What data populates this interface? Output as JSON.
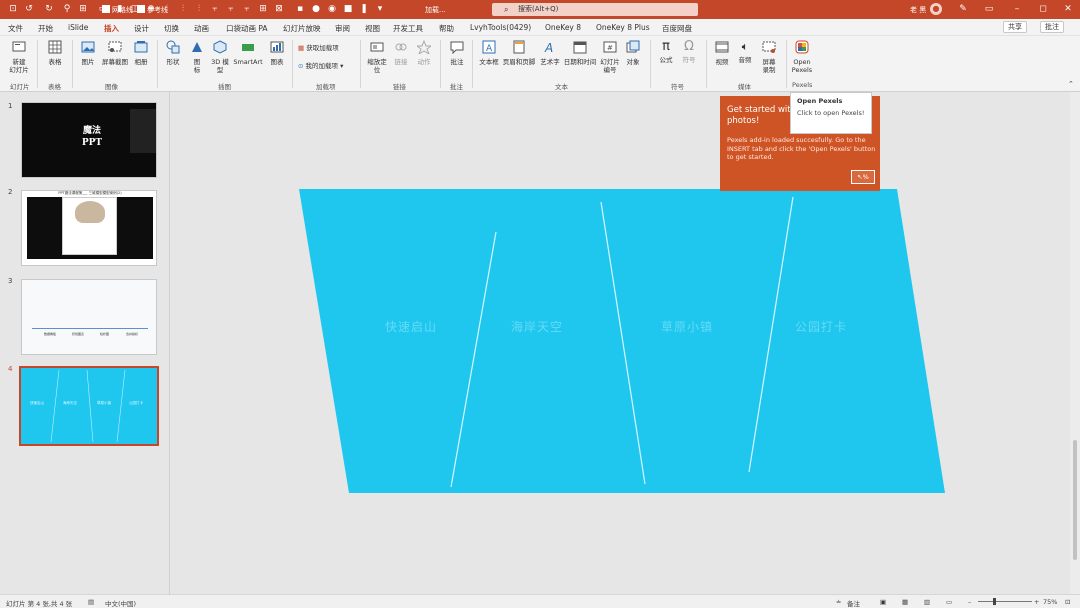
{
  "titlebar": {
    "grid_label": "网格线",
    "guide_label": "参考线",
    "doc_title": "加载...",
    "search_placeholder": "搜索(Alt+Q)",
    "user_name": "老 黑",
    "accent": "#c4472a"
  },
  "menu": {
    "tabs": [
      "文件",
      "开始",
      "iSlide",
      "插入",
      "设计",
      "切换",
      "动画",
      "口袋动画 PA",
      "幻灯片放映",
      "审阅",
      "视图",
      "开发工具",
      "帮助",
      "LvyhTools(0429)",
      "OneKey 8",
      "OneKey 8 Plus",
      "百度网盘"
    ],
    "active": "插入",
    "share": "共享",
    "comment": "批注"
  },
  "ribbon": {
    "buttons": {
      "new_slide": "新建\n幻灯片",
      "table": "表格",
      "picture": "图片",
      "screenshot": "屏幕截图",
      "album": "相册",
      "shapes": "形状",
      "icons": "图\n标",
      "model3d": "3D 模\n型",
      "smartart": "SmartArt",
      "chart": "图表",
      "get_addins": "获取加载项",
      "my_addins": "我的加载项",
      "zoom": "缩放定\n位",
      "link": "链接",
      "action": "动作",
      "comment": "批注",
      "textbox": "文本框",
      "header_footer": "页眉和页脚",
      "wordart": "艺术字",
      "datetime": "日期和时间",
      "slide_num": "幻灯片\n编号",
      "object": "对象",
      "equation": "公式",
      "symbol": "符号",
      "video": "视频",
      "audio": "音频",
      "screen_record": "屏幕\n录制",
      "open_pexels": "Open\nPexels"
    },
    "groups": {
      "slides": "幻灯片",
      "tables": "表格",
      "images": "图像",
      "illustrations": "插图",
      "addins": "加载项",
      "links": "链接",
      "comments": "批注",
      "text": "文本",
      "symbols": "符号",
      "media": "媒体",
      "pexels": "Pexels"
    }
  },
  "slides_panel": {
    "items": [
      {
        "num": "1",
        "title": "魔法\nPPT"
      },
      {
        "num": "2",
        "title": "PPT魔法课程第___ 三维模型模型案例(2)"
      },
      {
        "num": "3",
        "labels": [
          "数据看板",
          "折线图表",
          "柱状图",
          "合并指标"
        ]
      },
      {
        "num": "4",
        "labels": [
          "快速启山",
          "海岸天空",
          "草原小镇",
          "公园打卡"
        ]
      }
    ],
    "active": "4"
  },
  "slide": {
    "labels": [
      "快速启山",
      "海岸天空",
      "草原小镇",
      "公园打卡"
    ],
    "color": "#1fc7ef"
  },
  "pexels_popup": {
    "heading": "Get started with photos!",
    "body": "Pexels add-in loaded succesfully. Go to the INSERT tab and click the 'Open Pexels' button to get started.",
    "tooltip_title": "Open Pexels",
    "tooltip_body": "Click to open Pexels!",
    "cursor_label": "%"
  },
  "statusbar": {
    "slide_info": "幻灯片 第 4 张,共 4 张",
    "language": "中文(中国)",
    "notes": "备注",
    "zoom": "75%"
  }
}
